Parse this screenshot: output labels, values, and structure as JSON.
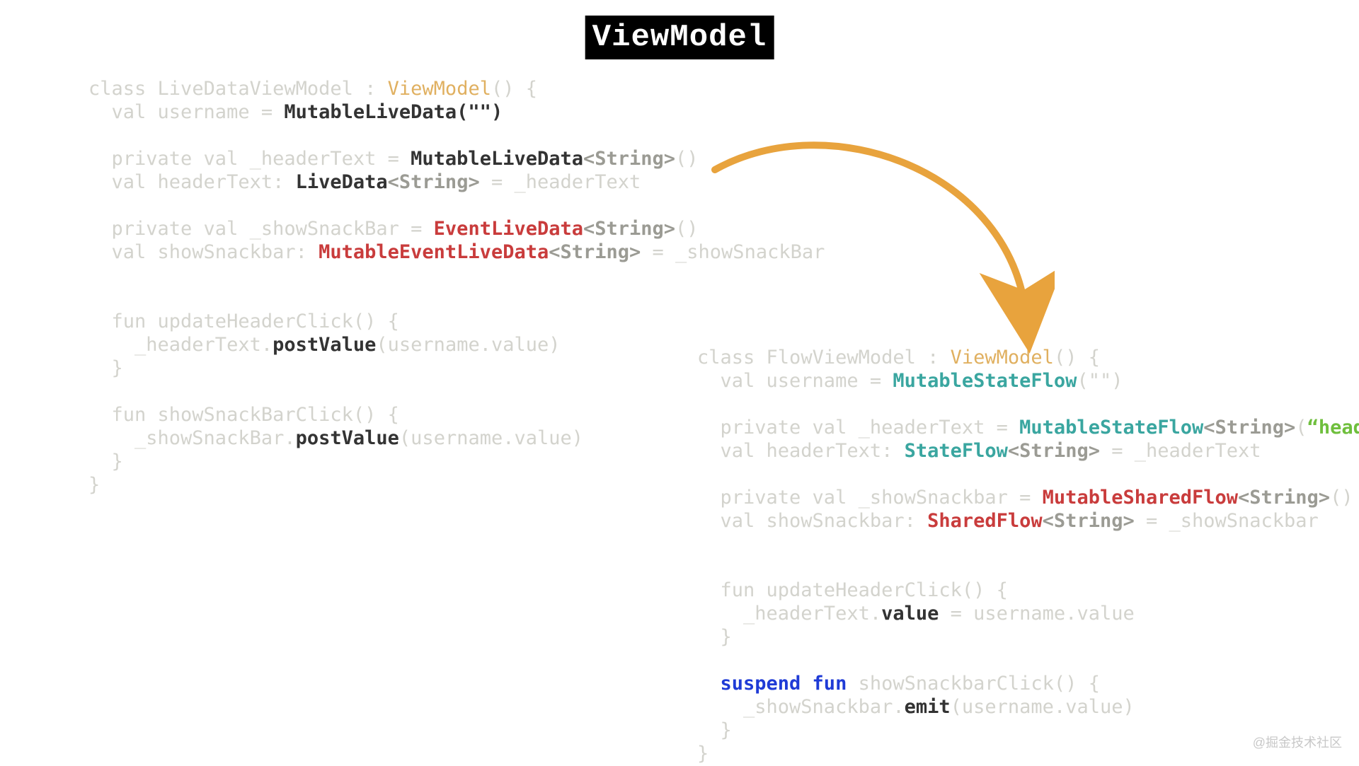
{
  "title": "ViewModel",
  "watermark": "@掘金技术社区",
  "left_code": {
    "l1": {
      "a": "class ",
      "b": "LiveDataViewModel : ",
      "c": "ViewModel",
      "d": "() {"
    },
    "l2": {
      "a": "  val username = ",
      "b": "MutableLiveData(\"\")"
    },
    "l3": {
      "a": "  private val _headerText = ",
      "b": "MutableLiveData",
      "c": "<String>",
      "d": "()"
    },
    "l4": {
      "a": "  val headerText: ",
      "b": "LiveData",
      "c": "<String>",
      "d": " = _headerText"
    },
    "l5": {
      "a": "  private val _showSnackBar = ",
      "b": "EventLiveData",
      "c": "<String>",
      "d": "()"
    },
    "l6": {
      "a": "  val showSnackbar: ",
      "b": "MutableEventLiveData",
      "c": "<String>",
      "d": " = _showSnackBar"
    },
    "l7": {
      "a": "  fun updateHeaderClick() {"
    },
    "l8": {
      "a": "    _headerText.",
      "b": "postValue",
      "c": "(username.value)"
    },
    "l9": {
      "a": "  }"
    },
    "l10": {
      "a": "  fun showSnackBarClick() {"
    },
    "l11": {
      "a": "    _showSnackBar.",
      "b": "postValue",
      "c": "(username.value)"
    },
    "l12": {
      "a": "  }"
    },
    "l13": {
      "a": "}"
    }
  },
  "right_code": {
    "r1": {
      "a": "class ",
      "b": "FlowViewModel : ",
      "c": "ViewModel",
      "d": "() {"
    },
    "r2": {
      "a": "  val username = ",
      "b": "MutableStateFlow",
      "c": "(\"\")"
    },
    "r3": {
      "a": "  private val _headerText = ",
      "b": "MutableStateFlow",
      "c": "<String>",
      "d": "(",
      "e": "“header”",
      "f": ")"
    },
    "r4": {
      "a": "  val headerText: ",
      "b": "StateFlow",
      "c": "<String>",
      "d": " = _headerText"
    },
    "r5": {
      "a": "  private val _showSnackbar = ",
      "b": "MutableSharedFlow",
      "c": "<String>",
      "d": "()"
    },
    "r6": {
      "a": "  val showSnackbar: ",
      "b": "SharedFlow",
      "c": "<String>",
      "d": " = _showSnackbar"
    },
    "r7": {
      "a": "  fun updateHeaderClick() {"
    },
    "r8": {
      "a": "    _headerText.",
      "b": "value",
      "c": " = username.value"
    },
    "r9": {
      "a": "  }"
    },
    "r10": {
      "a": "  suspend fun",
      "b": " showSnackbarClick() {"
    },
    "r11": {
      "a": "    _showSnackbar.",
      "b": "emit",
      "c": "(username.value)"
    },
    "r12": {
      "a": "  }"
    },
    "r13": {
      "a": "}"
    }
  }
}
